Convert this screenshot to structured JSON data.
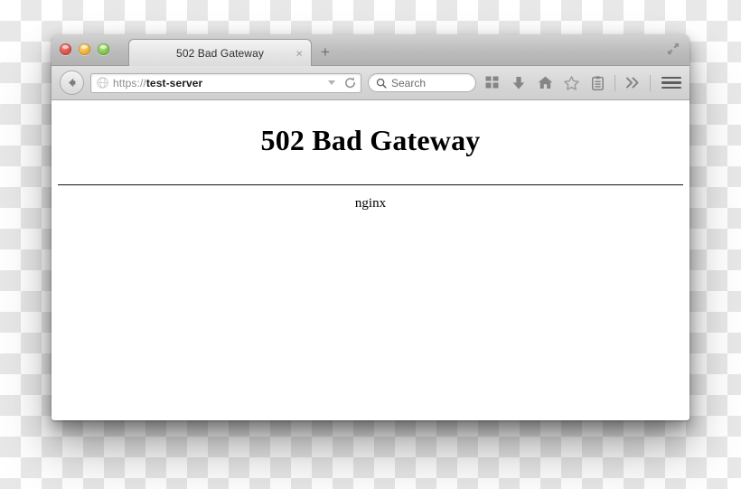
{
  "window": {
    "traffic_lights": [
      "close",
      "minimize",
      "zoom"
    ],
    "fullscreen_icon": "fullscreen-diagonal-arrows-icon"
  },
  "tabbar": {
    "active_tab_title": "502 Bad Gateway",
    "close_glyph": "×",
    "newtab_glyph": "+"
  },
  "toolbar": {
    "back_glyph": "←",
    "url": {
      "scheme": "https://",
      "host": "test-server",
      "favicon": "globe-icon",
      "dropdown": "chevron-down-icon",
      "reload": "reload-icon"
    },
    "search": {
      "placeholder": "Search",
      "icon": "search-icon"
    },
    "icons": [
      "apps-grid-icon",
      "download-arrow-icon",
      "home-icon",
      "bookmark-star-icon",
      "reading-list-icon",
      "overflow-chevrons-icon"
    ],
    "menu_icon": "hamburger-menu-icon"
  },
  "page": {
    "heading": "502 Bad Gateway",
    "server": "nginx"
  },
  "colors": {
    "traffic_red": "#e0564f",
    "traffic_yellow": "#f2b63f",
    "traffic_green": "#86ca54",
    "toolbar_bg": "#d6d6d6",
    "tabstrip_bg": "#bcbcbc",
    "page_bg": "#ffffff",
    "text": "#000000"
  }
}
